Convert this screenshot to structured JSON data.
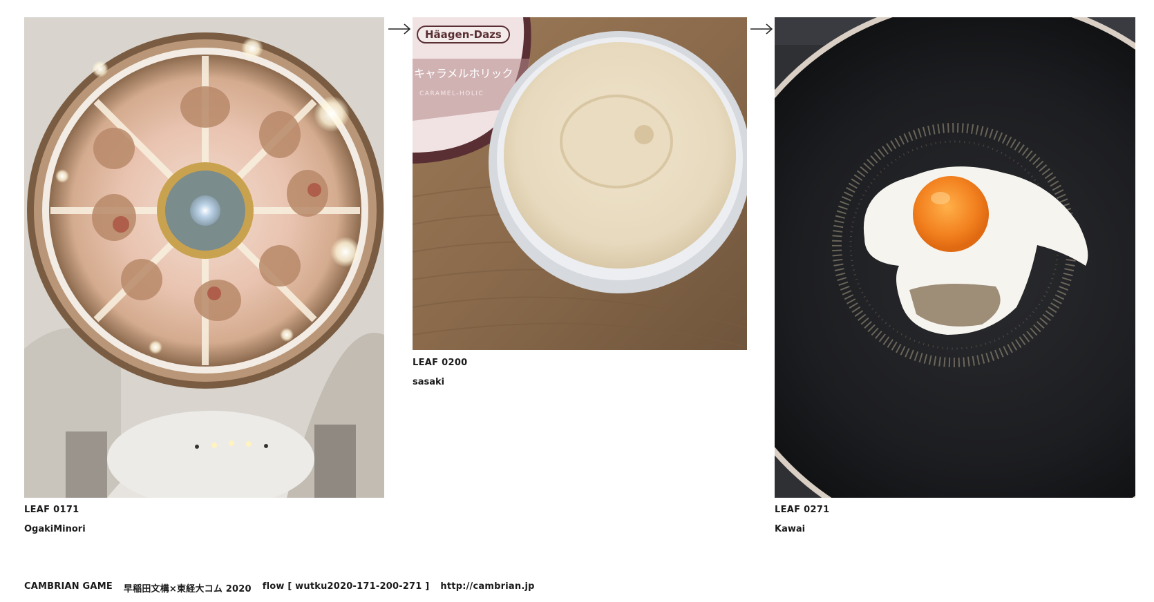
{
  "leaves": [
    {
      "id": "LEAF 0171",
      "author": "OgakiMinori",
      "image": "baroque-dome-ceiling-photo"
    },
    {
      "id": "LEAF 0200",
      "author": "sasaki",
      "image": "ice-cream-cup-photo",
      "brand_text": "Häagen-Dazs",
      "jp_text": "キャラメルホリック",
      "sub_text": "CARAMEL-HOLIC"
    },
    {
      "id": "LEAF 0271",
      "author": "Kawai",
      "image": "fried-egg-pan-photo"
    }
  ],
  "arrows": [
    "right-arrow-icon",
    "right-arrow-icon"
  ],
  "footer": {
    "title": "CAMBRIAN GAME",
    "project": "早稲田文構×東経大コム 2020",
    "flow": "flow [ wutku2020-171-200-271 ]",
    "url": "http://cambrian.jp"
  },
  "colors": {
    "text": "#1a1a1a",
    "background": "#ffffff"
  }
}
